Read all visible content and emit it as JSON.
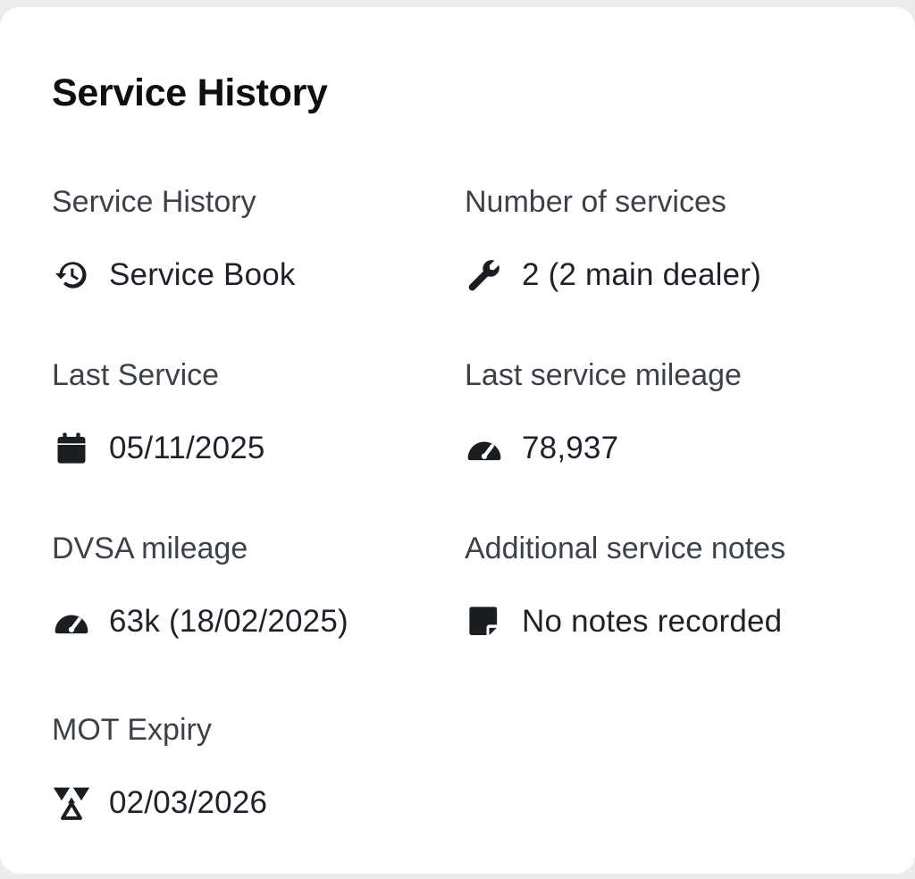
{
  "card": {
    "title": "Service History"
  },
  "fields": {
    "service_history": {
      "label": "Service History",
      "value": "Service Book",
      "icon": "history-icon"
    },
    "number_of_services": {
      "label": "Number of services",
      "value": "2 (2 main dealer)",
      "icon": "wrench-icon"
    },
    "last_service": {
      "label": "Last Service",
      "value": "05/11/2025",
      "icon": "calendar-icon"
    },
    "last_service_mileage": {
      "label": "Last service mileage",
      "value": "78,937",
      "icon": "speedometer-icon"
    },
    "dvsa_mileage": {
      "label": "DVSA mileage",
      "value": "63k (18/02/2025)",
      "icon": "speedometer-icon"
    },
    "additional_notes": {
      "label": "Additional service notes",
      "value": "No notes recorded",
      "icon": "sticky-note-icon"
    },
    "mot_expiry": {
      "label": "MOT Expiry",
      "value": "02/03/2026",
      "icon": "mot-triangles-icon"
    }
  },
  "colors": {
    "text_primary": "#0f0f12",
    "text_label": "#3d4148",
    "icon": "#1a1d22",
    "card_bg": "#ffffff"
  }
}
